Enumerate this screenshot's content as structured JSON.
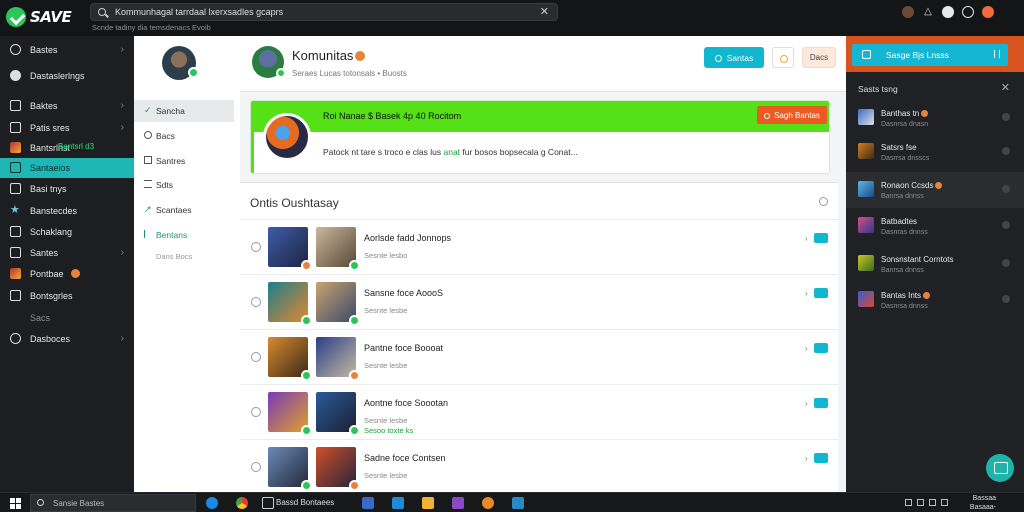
{
  "app": {
    "logo_text": "SAVE"
  },
  "search": {
    "value": "Kommunhagal tarrdaal lxerxsadles gcaprs",
    "subtitle": "Scnde tadiny dia temsdenacs Evoib"
  },
  "sidebar": {
    "items": [
      {
        "label": "Bastes",
        "icon": "shield-icon",
        "chevron": "›"
      },
      {
        "label": "Dastaslerlngs",
        "icon": "disc-icon",
        "chevron": ""
      },
      {
        "label": "Baktes",
        "icon": "film-icon",
        "chevron": "›"
      },
      {
        "label": "Patis sres",
        "icon": "folder-icon",
        "chevron": "›"
      },
      {
        "label": "Bantsrlnst",
        "badge": "Bantsrl d3",
        "icon": "game-icon",
        "chevron": ""
      },
      {
        "label": "Santaeios",
        "icon": "community-icon",
        "chevron": "",
        "active": true
      },
      {
        "label": "Basi tnys",
        "icon": "book-icon",
        "chevron": ""
      },
      {
        "label": "Banstecdes",
        "icon": "star-icon",
        "chevron": ""
      },
      {
        "label": "Schaklang",
        "icon": "tag-icon",
        "chevron": ""
      },
      {
        "label": "Santes",
        "icon": "grid-icon",
        "chevron": "›"
      },
      {
        "label": "Pontbae",
        "icon": "avatar-icon",
        "chevron": ""
      },
      {
        "label": "Bontsgrles",
        "icon": "list-icon",
        "chevron": ""
      },
      {
        "label": "Sacs",
        "icon": "",
        "chevron": "",
        "dim": true
      },
      {
        "label": "Dasboces",
        "icon": "settings-icon",
        "chevron": "›"
      }
    ]
  },
  "profile_menu": {
    "items": [
      {
        "label": "Sancha",
        "icon": "check-icon",
        "active": true
      },
      {
        "label": "Bacs",
        "icon": "clock-icon"
      },
      {
        "label": "Santres",
        "icon": "users-icon"
      },
      {
        "label": "Sdts",
        "icon": "list-icon"
      },
      {
        "label": "Scantaes",
        "icon": "arrow-icon"
      },
      {
        "label": "Bentans",
        "icon": "flag-icon",
        "green": true
      },
      {
        "label": "Dans Bocs",
        "icon": "",
        "faint": true
      }
    ]
  },
  "community": {
    "title": "Komunitas",
    "subtitle": "Seraes Lucas totonsals • Buosts",
    "primary_button": "Santas",
    "secondary_button": "Dacs"
  },
  "promo": {
    "title": "Roi Nanae $ Basek 4p 40 Rocitom",
    "description_start": "Patock nt tare s troco e clas lus",
    "description_green": "anat",
    "description_end": "fur bosos bopsecala g Conat...",
    "button": "Sagh Bantas"
  },
  "list": {
    "title": "Ontis Oushtasay",
    "rows": [
      {
        "title": "Aorlsde fadd Jonnops",
        "sub": "Sesnte lesbo",
        "sub2": ""
      },
      {
        "title": "Sansne foce AoooS",
        "sub": "Sesnte lesbe",
        "sub2": ""
      },
      {
        "title": "Pantne foce Boooat",
        "sub": "Sesnte lesbe",
        "sub2": ""
      },
      {
        "title": "Aontne foce Soootan",
        "sub": "Sesnte lesbe",
        "sub2": "Sesoo toxte ks"
      },
      {
        "title": "Sadne foce Contsen",
        "sub": "Sesnte lesbe",
        "sub2": ""
      }
    ]
  },
  "right_panel": {
    "button": "Sasge Bjs Lnsss",
    "title": "Sasts tsng",
    "items": [
      {
        "name": "Banthas tn",
        "sub": "Dasnrsa dnasn"
      },
      {
        "name": "Satsrs fse",
        "sub": "Dasrrsa dnsscs"
      },
      {
        "name": "Ronaon Ccsds",
        "sub": "Banrsa dnnss"
      },
      {
        "name": "Batbadtes",
        "sub": "Dasnras dnnss"
      },
      {
        "name": "Sonsnstant Corntots",
        "sub": "Banrsa dnnss"
      },
      {
        "name": "Bantas Ints",
        "sub": "Dasnrsa dnnss"
      }
    ]
  },
  "taskbar": {
    "search_text": "Sansie Bastes",
    "app_label": "Bassd Bontaees",
    "clock_time": "Bassaa",
    "clock_date": "Basaaa-Basaa"
  }
}
